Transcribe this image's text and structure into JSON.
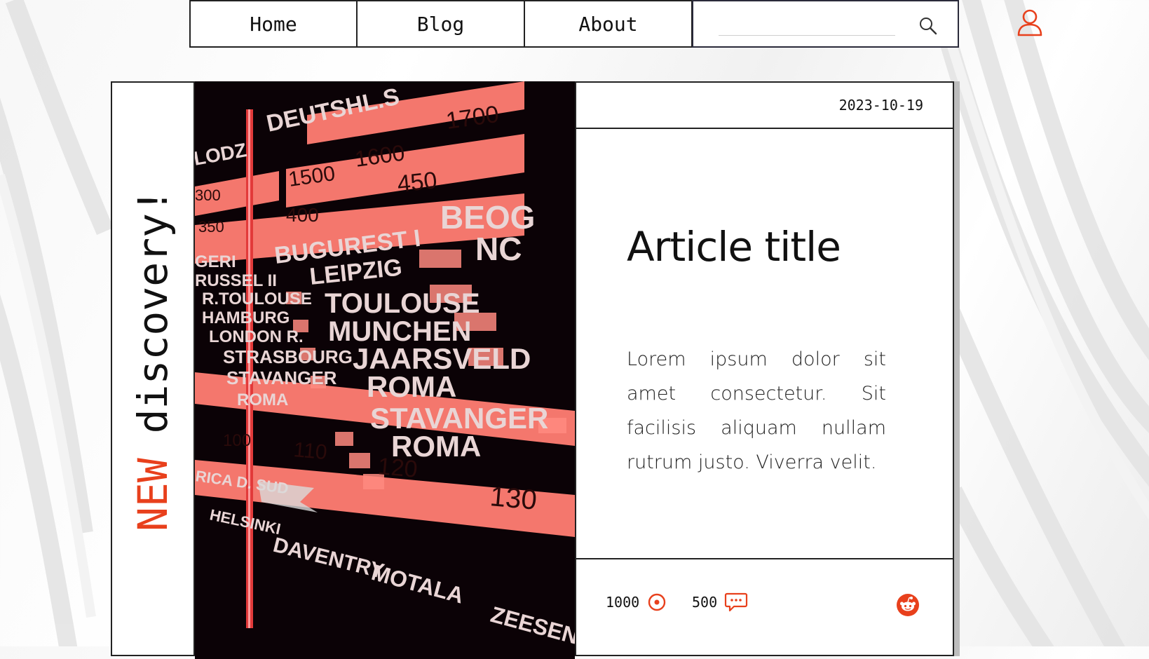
{
  "nav": {
    "tabs": [
      "Home",
      "Blog",
      "About"
    ],
    "search_placeholder": ""
  },
  "icons": {
    "search": "search-icon",
    "user": "user-icon",
    "views": "eye-icon",
    "comments": "comment-icon",
    "reddit": "reddit-icon"
  },
  "colors": {
    "accent": "#e8401c",
    "text": "#111111",
    "border": "#222222"
  },
  "card": {
    "badge_new": "NEW",
    "badge_text": "discovery!",
    "date": "2023-10-19",
    "title": "Article title",
    "body": "Lorem ipsum dolor sit amet consectetur. Sit facilisis aliquam nullam rutrum justo. Viverra velit.",
    "views": "1000",
    "comments": "500"
  },
  "photo": {
    "stations": [
      "DEUTSHL.S",
      "LODZ",
      "BUGUREST I",
      "LEIPZIG",
      "TOULOUSE",
      "MUNCHEN",
      "JAARSVELD",
      "ROMA",
      "STAVANGER",
      "ROMA",
      "BEOG",
      "NC",
      "GERI",
      "RUSSEL II",
      "R.TOULOUSE",
      "HAMBURG",
      "LONDON R.",
      "STRASBOURG",
      "STAVANGER",
      "ROMA",
      "DAVENTRY",
      "MOTALA",
      "ZEESEN",
      "HELSINKI",
      "RICA D. SUD"
    ],
    "frequencies": [
      "1700",
      "1600",
      "1500",
      "450",
      "400",
      "350",
      "300",
      "100",
      "110",
      "120",
      "130"
    ]
  }
}
